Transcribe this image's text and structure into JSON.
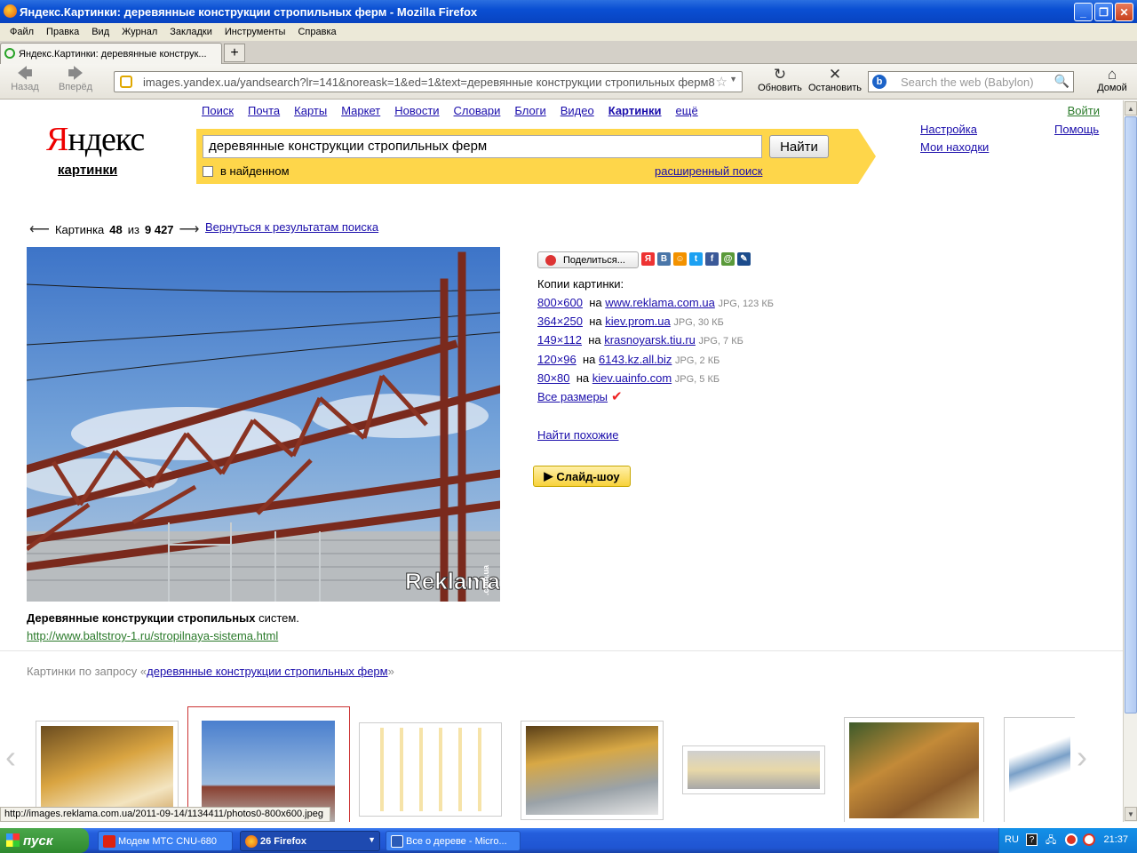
{
  "window": {
    "title": "Яндекс.Картинки: деревянные конструкции стропильных ферм - Mozilla Firefox"
  },
  "menu": [
    "Файл",
    "Правка",
    "Вид",
    "Журнал",
    "Закладки",
    "Инструменты",
    "Справка"
  ],
  "tab": {
    "label": "Яндекс.Картинки: деревянные конструк..."
  },
  "toolbar": {
    "back": "Назад",
    "forward": "Вперёд",
    "url": "images.yandex.ua/yandsearch?lr=141&noreask=1&ed=1&text=деревянные конструкции стропильных ферм8",
    "reload": "Обновить",
    "stop": "Остановить",
    "search_placeholder": "Search the web (Babylon)",
    "home": "Домой"
  },
  "yandex": {
    "logo_first": "Я",
    "logo_rest": "ндекс",
    "logo_sub": "картинки",
    "nav": [
      "Поиск",
      "Почта",
      "Карты",
      "Маркет",
      "Новости",
      "Словари",
      "Блоги",
      "Видео",
      "Картинки",
      "ещё"
    ],
    "nav_current": "Картинки",
    "login": "Войти",
    "settings": "Настройка",
    "help": "Помощь",
    "finds": "Мои находки",
    "query": "деревянные конструкции стропильных ферм",
    "search_button": "Найти",
    "in_found": "в найденном",
    "advanced": "расширенный поиск"
  },
  "pager": {
    "prefix": "Картинка",
    "current": "48",
    "of": "из",
    "total": "9 427",
    "back": "Вернуться к результатам поиска"
  },
  "image": {
    "watermark": "Reklama",
    "watermark_side": ".com.ua",
    "caption_bold": "Деревянные конструкции стропильных",
    "caption_rest": " систем.",
    "source_url": "http://www.baltstroy-1.ru/stropilnaya-sistema.html"
  },
  "share": {
    "label": "Поделиться...",
    "icons": [
      "ya-icon",
      "vk-icon",
      "odnoklassniki-icon",
      "twitter-icon",
      "facebook-icon",
      "moimir-icon",
      "livejournal-icon"
    ]
  },
  "copies": {
    "title": "Копии картинки:",
    "on": "на",
    "rows": [
      {
        "size": "800×600",
        "site": "www.reklama.com.ua",
        "meta": "JPG, 123 КБ"
      },
      {
        "size": "364×250",
        "site": "kiev.prom.ua",
        "meta": "JPG, 30 КБ"
      },
      {
        "size": "149×112",
        "site": "krasnoyarsk.tiu.ru",
        "meta": "JPG, 7 КБ"
      },
      {
        "size": "120×96",
        "site": "6143.kz.all.biz",
        "meta": "JPG, 2 КБ"
      },
      {
        "size": "80×80",
        "site": "kiev.uainfo.com",
        "meta": "JPG, 5 КБ"
      }
    ],
    "all_sizes": "Все размеры",
    "similar": "Найти похожие"
  },
  "slideshow": "Слайд-шоу",
  "related": {
    "prefix": "Картинки по запросу «",
    "link": "деревянные конструкции стропильных ферм",
    "suffix": "»"
  },
  "status": "http://images.reklama.com.ua/2011-09-14/1134411/photos0-800x600.jpeg",
  "taskbar": {
    "start": "пуск",
    "tasks": [
      "Модем МТС CNU-680",
      "26 Firefox",
      "Все о дереве - Micro..."
    ],
    "lang": "RU",
    "time": "21:37"
  }
}
